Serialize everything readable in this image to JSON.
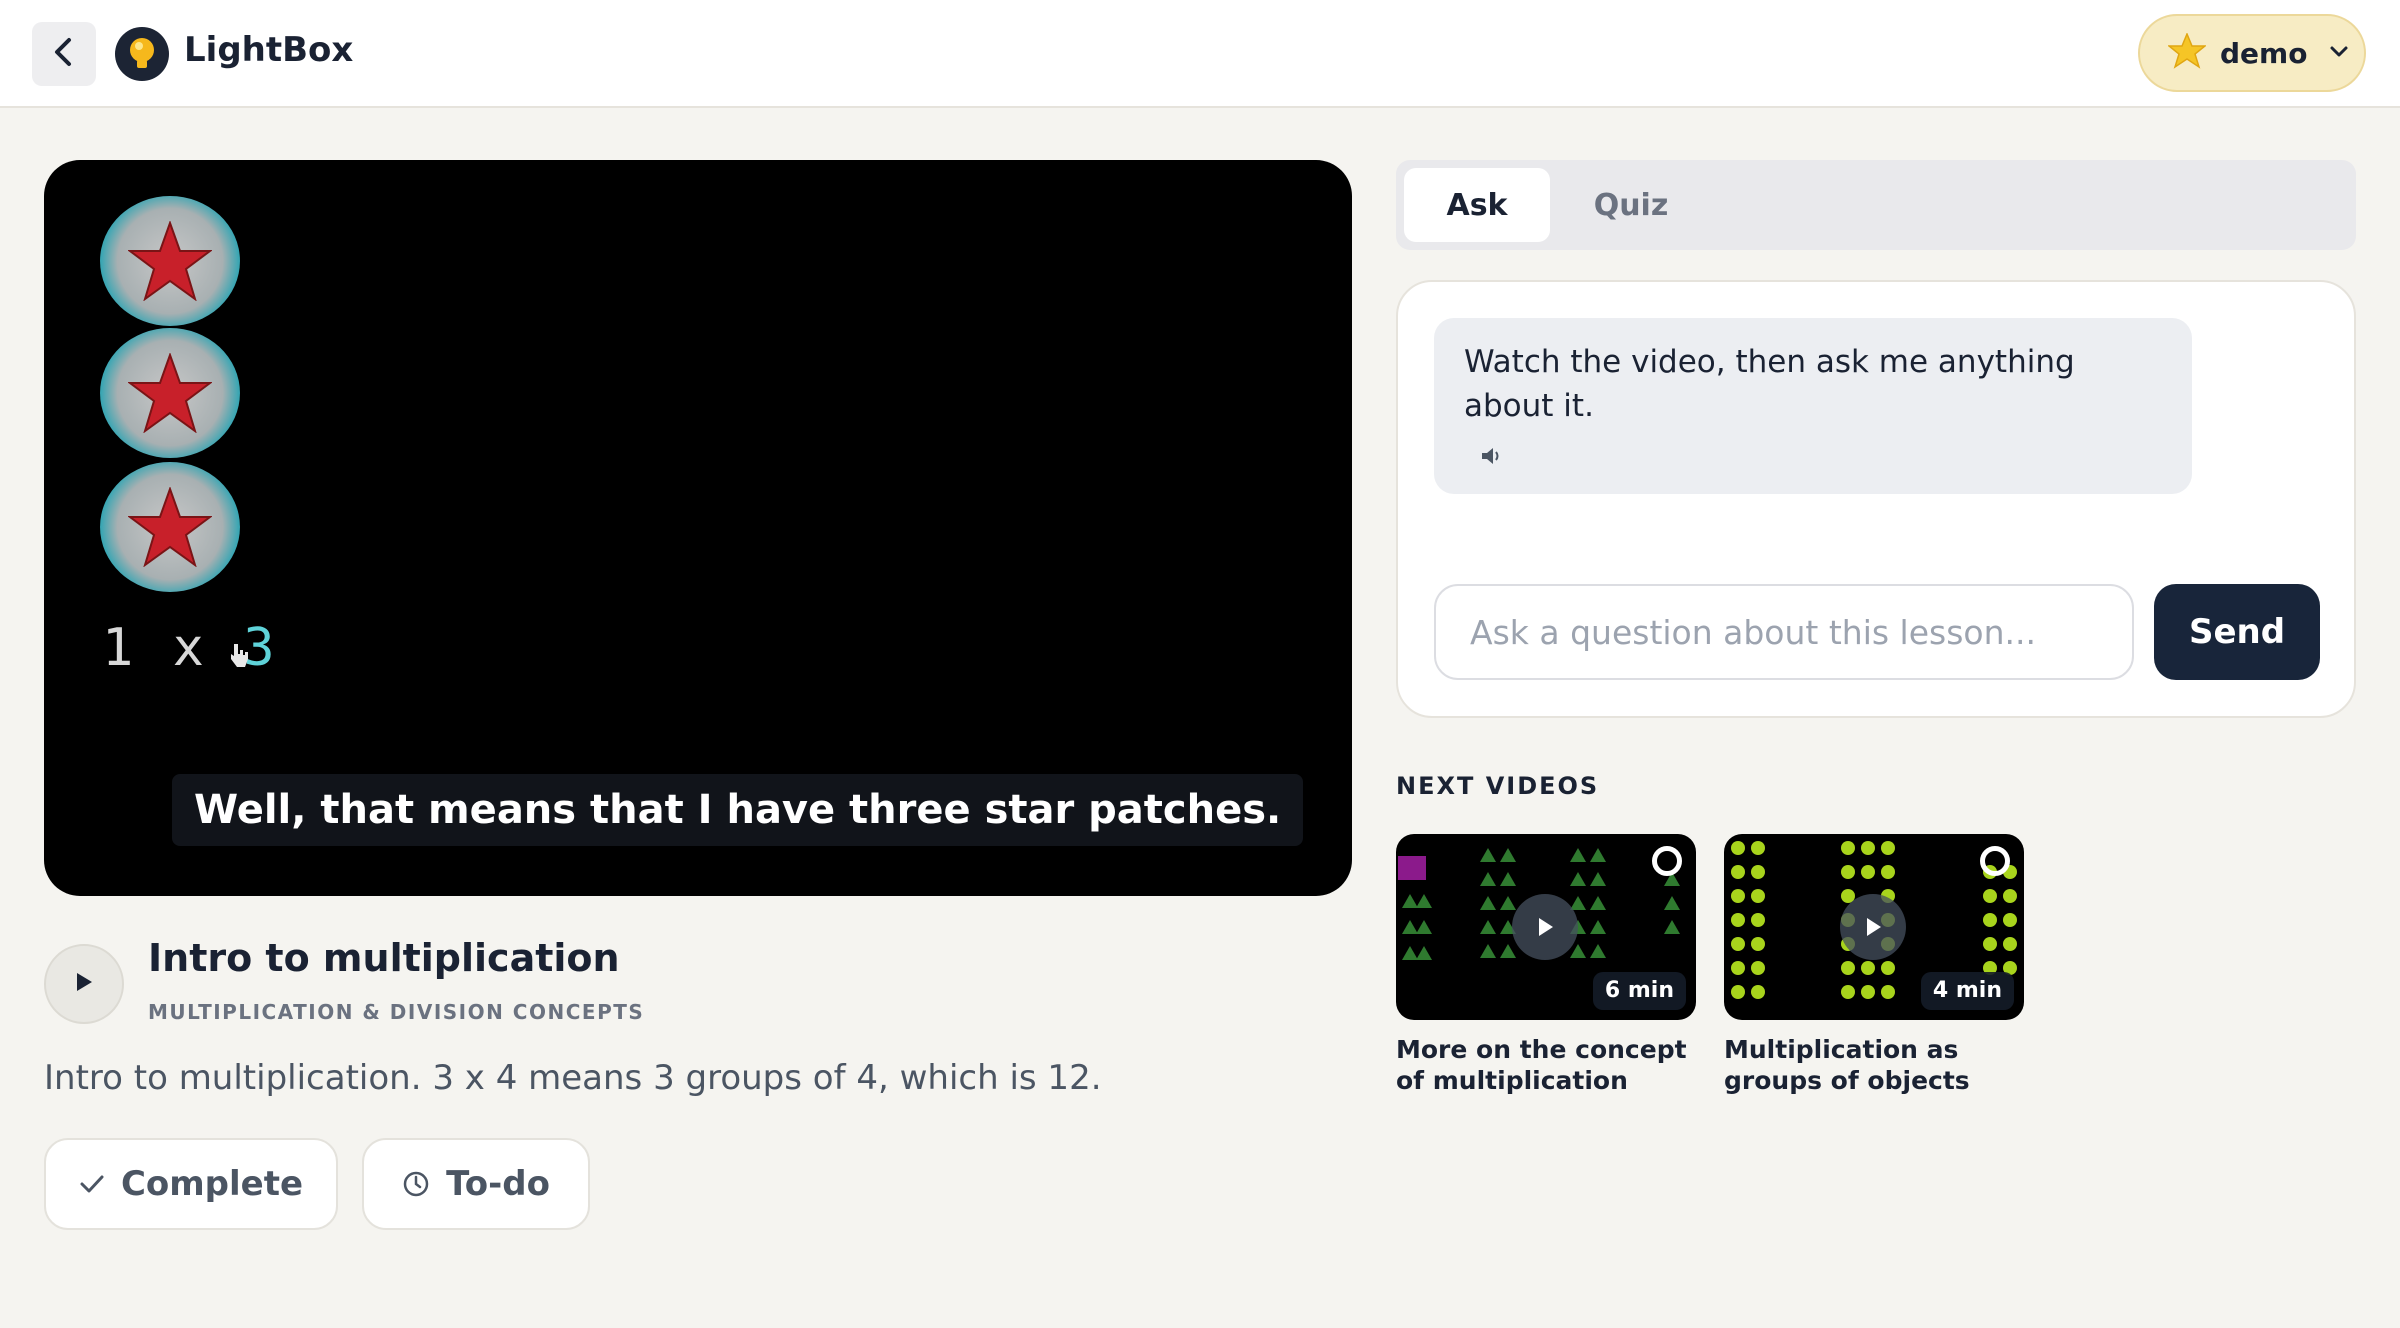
{
  "header": {
    "brand": "LightBox",
    "user_name": "demo"
  },
  "video": {
    "formula_left": "1 x ",
    "formula_three": "3",
    "caption": "Well, that means that I have three star patches."
  },
  "lesson": {
    "title": "Intro to multiplication",
    "subtitle": "MULTIPLICATION & DIVISION CONCEPTS",
    "description": "Intro to multiplication. 3 x 4 means 3 groups of 4, which is 12.",
    "complete_label": "Complete",
    "todo_label": "To-do"
  },
  "panel": {
    "tabs": [
      {
        "label": "Ask",
        "active": true
      },
      {
        "label": "Quiz",
        "active": false
      }
    ],
    "assistant_message": "Watch the video, then ask me anything about it.",
    "input_placeholder": "Ask a question about this lesson...",
    "input_value": "",
    "send_label": "Send"
  },
  "next_videos": {
    "heading": "NEXT VIDEOS",
    "items": [
      {
        "title": "More on the concept of multiplication",
        "duration": "6 min"
      },
      {
        "title": "Multiplication as groups of objects",
        "duration": "4 min"
      }
    ]
  },
  "colors": {
    "primary_dark": "#18253a",
    "user_pill_bg": "#f7ecc4",
    "page_bg": "#f5f4f0",
    "thumb_dots_green": "#b5e61d"
  },
  "icons": [
    "back-arrow-icon",
    "lightbulb-logo-icon",
    "star-icon",
    "chevron-down-icon",
    "play-icon",
    "check-icon",
    "clock-icon",
    "speaker-icon"
  ]
}
